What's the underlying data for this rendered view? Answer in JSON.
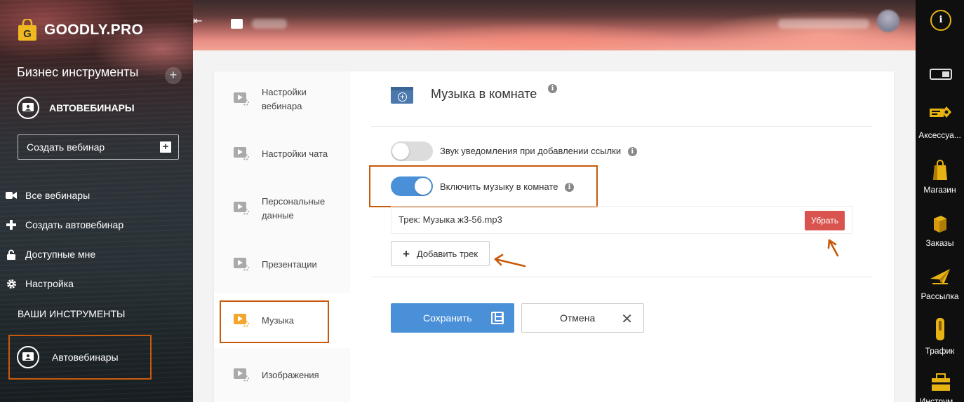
{
  "brand": {
    "logo_text": "GOODLY.PRO",
    "logo_letter": "G"
  },
  "sidebar": {
    "business_title": "Бизнес инструменты",
    "add_symbol": "+",
    "section_label": "АВТОВЕБИНАРЫ",
    "create_webinar_label": "Создать вебинар",
    "items": [
      {
        "label": "Все вебинары",
        "icon": "video-camera-icon"
      },
      {
        "label": "Создать автовебинар",
        "icon": "plus-icon"
      },
      {
        "label": "Доступные мне",
        "icon": "lock-icon"
      },
      {
        "label": "Настройка",
        "icon": "gear-icon"
      }
    ],
    "tools_title": "ВАШИ ИНСТРУМЕНТЫ",
    "tool_item_label": "Автовебинары"
  },
  "header": {
    "collapse_symbol": "⇤"
  },
  "rightbar": {
    "info_symbol": "i",
    "items": [
      {
        "label": "Аксессуа...",
        "icon": "accessories-icon"
      },
      {
        "label": "Магазин",
        "icon": "shopping-bag-icon"
      },
      {
        "label": "Заказы",
        "icon": "orders-box-icon"
      },
      {
        "label": "Рассылка",
        "icon": "paper-plane-icon"
      },
      {
        "label": "Трафик",
        "icon": "traffic-icon"
      },
      {
        "label": "Инструм...",
        "icon": "toolbox-icon"
      }
    ]
  },
  "settings_nav": {
    "items": [
      {
        "label": "Настройки вебинара"
      },
      {
        "label": "Настройки чата"
      },
      {
        "label": "Персональные данные"
      },
      {
        "label": "Презентации"
      },
      {
        "label": "Музыка",
        "active": true
      },
      {
        "label": "Изображения"
      }
    ]
  },
  "music": {
    "title": "Музыка в комнате",
    "notify_toggle": {
      "label": "Звук уведомления при добавлении ссылки",
      "on": false
    },
    "music_toggle": {
      "label": "Включить музыку в комнате",
      "on": true
    },
    "track_text": "Трек: Музыка ж3-56.mp3",
    "remove_label": "Убрать",
    "add_track_label": "Добавить трек",
    "save_label": "Сохранить",
    "cancel_label": "Отмена"
  },
  "colors": {
    "accent_blue": "#4a90d9",
    "danger_red": "#d9534f",
    "highlight_orange": "#c8590a",
    "nav_active_orange": "#f3a62c"
  }
}
